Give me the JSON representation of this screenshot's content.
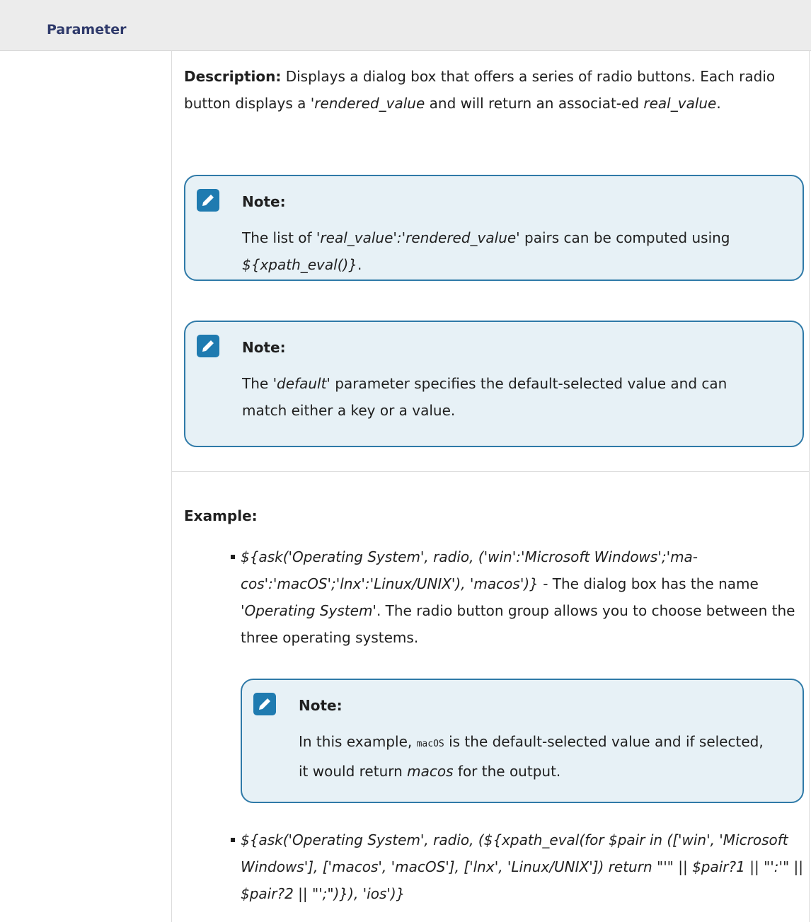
{
  "table": {
    "header": "Parameter"
  },
  "description": {
    "label": "Description:",
    "text_1": " Displays a dialog box that offers a series of radio buttons. Each radio button displays a ",
    "italic_1": "'rendered_value",
    "text_2": " and will return an associat-ed ",
    "italic_2": "real_value",
    "text_3": "."
  },
  "notes": [
    {
      "title": "Note:",
      "text_1": "The list of ",
      "italic_1": "'real_value':'rendered_value'",
      "text_2": " pairs can be computed using ",
      "italic_2": "${xpath_eval()}",
      "text_3": "."
    },
    {
      "title": "Note:",
      "text_1": "The ",
      "italic_1": "'default'",
      "text_2": " parameter specifies the default-selected value and can match either a key or a value."
    }
  ],
  "example": {
    "label": "Example:",
    "item_1": {
      "code": "${ask('Operating System', radio, ('win':'Microsoft Windows';'ma-cos':'macOS';'lnx':'Linux/UNIX'), 'macos')}",
      "text_1": " - The dialog box has the name ",
      "italic_1": "'Operating System'",
      "text_2": ". The radio button group allows you to choose between the three operating systems."
    },
    "note": {
      "title": "Note:",
      "text_1": "In this example, ",
      "code": "macOS",
      "text_2": " is the default-selected value and if selected, it would return ",
      "italic_1": "macos",
      "text_3": " for the output."
    },
    "item_2": {
      "code": "${ask('Operating System', radio, (${xpath_eval(for $pair in (['win', 'Microsoft Windows'], ['macos', 'macOS'], ['lnx', 'Linux/UNIX']) return \"'\" || $pair?1 || \"':'\" || $pair?2 || \"';\")}), 'ios')}"
    }
  },
  "icons": {
    "note_icon": "pencil-note-icon"
  },
  "colors": {
    "header_bg": "#ececec",
    "header_text": "#2f3a6b",
    "note_bg": "#e7f1f6",
    "note_border": "#2f7aa8",
    "note_icon_bg": "#1f7bb0"
  }
}
